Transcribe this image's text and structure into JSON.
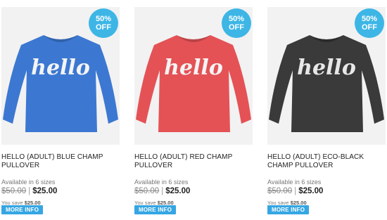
{
  "colors": {
    "badge": "#3db6e6",
    "button": "#35a6e3",
    "sweater_blue": "#3c78d2",
    "sweater_red": "#e45256",
    "sweater_black": "#3a3a3a"
  },
  "products": [
    {
      "badge_top": "50%",
      "badge_bottom": "OFF",
      "title": "HELLO (ADULT) BLUE CHAMP PULLOVER",
      "availability": "Available in 6 sizes",
      "old_price": "$50.00",
      "separator": "|",
      "new_price": "$25.00",
      "save_label": "You save",
      "save_amount": "$25.00",
      "button_label": "MORE INFO",
      "image_text": "hello"
    },
    {
      "badge_top": "50%",
      "badge_bottom": "OFF",
      "title": "HELLO (ADULT) RED CHAMP PULLOVER",
      "availability": "Available in 6 sizes",
      "old_price": "$50.00",
      "separator": "|",
      "new_price": "$25.00",
      "save_label": "You save",
      "save_amount": "$25.00",
      "button_label": "MORE INFO",
      "image_text": "hello"
    },
    {
      "badge_top": "50%",
      "badge_bottom": "OFF",
      "title": "HELLO (ADULT) ECO-BLACK CHAMP PULLOVER",
      "availability": "Available in 6 sizes",
      "old_price": "$50.00",
      "separator": "|",
      "new_price": "$25.00",
      "save_label": "You save",
      "save_amount": "$25.00",
      "button_label": "MORE INFO",
      "image_text": "hello"
    }
  ]
}
